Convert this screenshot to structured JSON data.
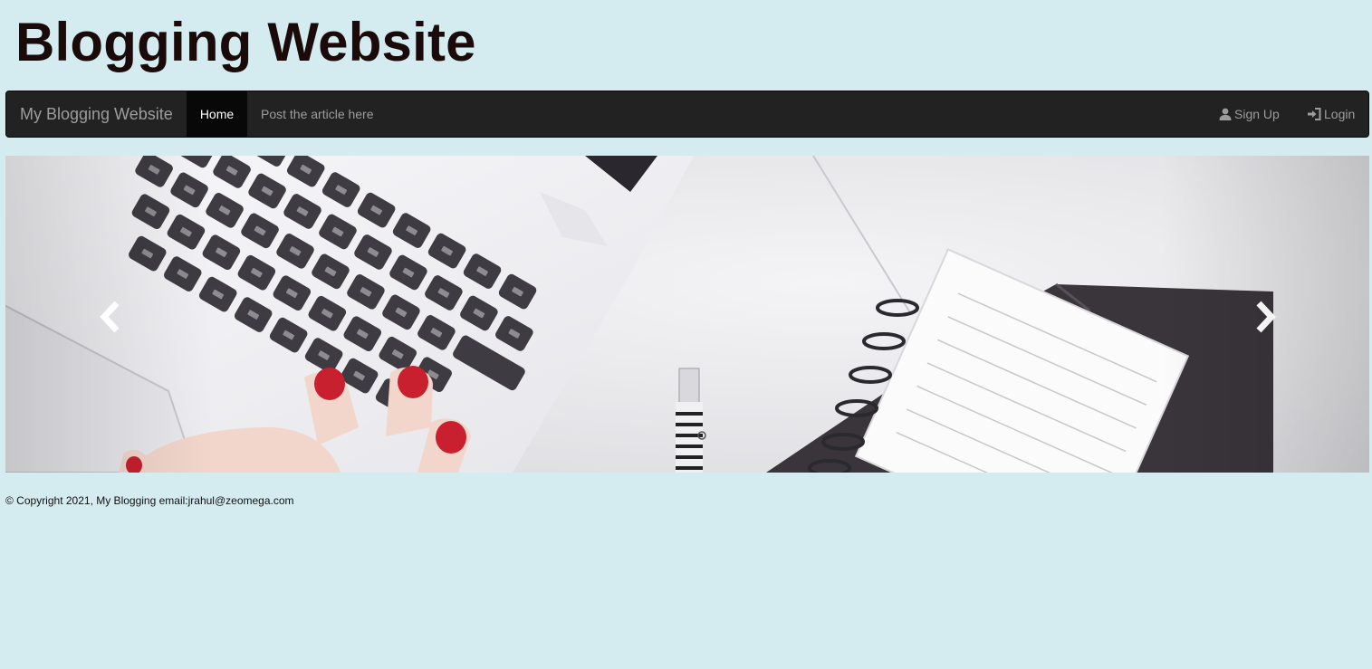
{
  "header": {
    "title": "Blogging Website"
  },
  "navbar": {
    "brand": "My Blogging Website",
    "items": [
      {
        "label": "Home",
        "active": true
      },
      {
        "label": "Post the article here",
        "active": false
      }
    ],
    "right_items": [
      {
        "label": "Sign Up",
        "icon": "user-icon"
      },
      {
        "label": "Login",
        "icon": "login-icon"
      }
    ]
  },
  "carousel": {
    "image_subject": "laptop-keyboard-with-notebook",
    "prev_icon": "chevron-left-icon",
    "next_icon": "chevron-right-icon"
  },
  "footer": {
    "copyright": "© Copyright 2021, My Blogging email:jrahul@zeomega.com"
  },
  "colors": {
    "page_background": "#d4ecf0",
    "navbar_background": "#222222",
    "navbar_active": "#080808",
    "navbar_text": "#9d9d9d",
    "title_text": "#1a0a0a"
  }
}
